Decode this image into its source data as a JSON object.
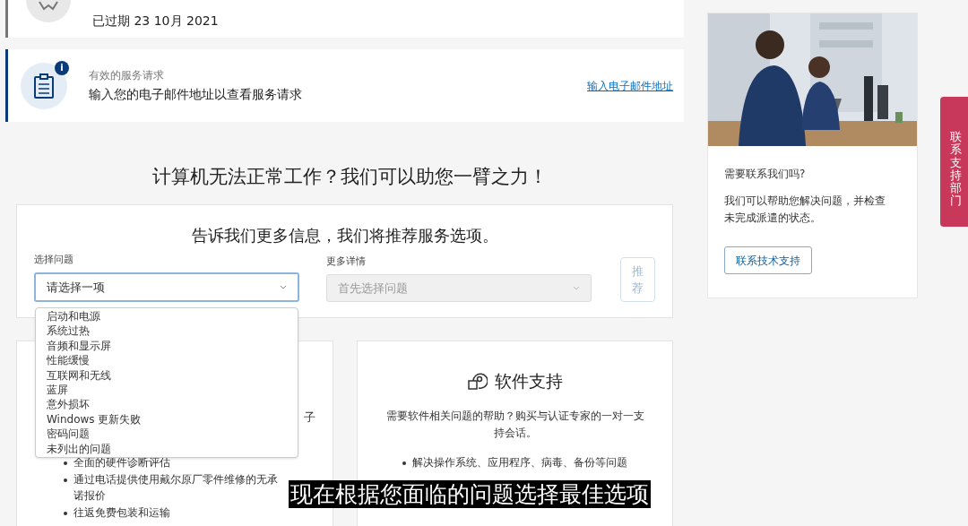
{
  "expired_card": {
    "text": "已过期 23 10月 2021"
  },
  "service_card": {
    "label": "有效的服务请求",
    "text": "输入您的电子邮件地址以查看服务请求",
    "link": "输入电子邮件地址",
    "badge": "i"
  },
  "heading": "计算机无法正常工作？我们可以助您一臂之力！",
  "form": {
    "title": "告诉我们更多信息，我们将推荐服务选项。",
    "issue": {
      "label": "选择问题",
      "value": "请选择一项",
      "expanded": true,
      "options": [
        {
          "label": "启动和电源"
        },
        {
          "label": "系统过热"
        },
        {
          "label": "音频和显示屏"
        },
        {
          "label": "性能缓慢"
        },
        {
          "label": "互联网和无线"
        },
        {
          "label": "蓝屏"
        },
        {
          "label": "意外损坏"
        },
        {
          "label": "Windows 更新失败"
        },
        {
          "label": "密码问题"
        },
        {
          "label": "未列出的问题"
        }
      ]
    },
    "details": {
      "label": "更多详情",
      "placeholder": "首先选择问题",
      "disabled": true
    },
    "recommend_button": {
      "label": "推荐",
      "disabled": true
    }
  },
  "hardware_card": {
    "fragment": "子",
    "bullets": [
      {
        "text": "全面的硬件诊断评估"
      },
      {
        "text": "通过电话提供使用戴尔原厂零件维修的无承诺报价"
      },
      {
        "text": "往返免费包装和运输"
      }
    ]
  },
  "software_card": {
    "title": "软件支持",
    "description": "需要软件相关问题的帮助？购买与认证专家的一对一支持会话。",
    "bullets": [
      {
        "text": "解决操作系统、应用程序、病毒、备份等问题"
      }
    ]
  },
  "contact_card": {
    "title": "需要联系我们吗?",
    "text": "我们可以帮助您解决问题，并检查未完成派遣的状态。",
    "button": "联系技术支持"
  },
  "side_tab": "联系支持部门",
  "subtitle": "现在根据您面临的问题选择最佳选项"
}
